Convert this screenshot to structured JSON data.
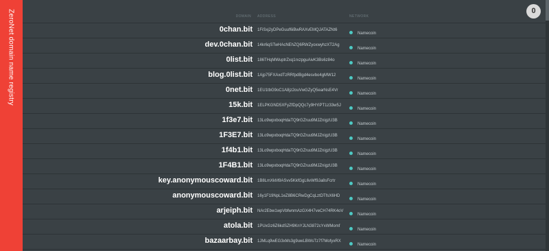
{
  "sidebar": {
    "title": "ZeroNet domain name registry"
  },
  "badge": {
    "count": "0"
  },
  "table": {
    "headers": {
      "domain": "DOMAIN",
      "address": "ADDRESS",
      "network": "NETWORK"
    },
    "rows": [
      {
        "domain": "0chan.bit",
        "address": "1FiSxj2yDPeGuuf6iBwRAXvEMQJATAZNt6",
        "network": "Namecoin"
      },
      {
        "domain": "dev.0chan.bit",
        "address": "14kr6qSTwHAcNEhZQ6RWZyoxwyhzXT2Ag",
        "network": "Namecoin"
      },
      {
        "domain": "0list.bit",
        "address": "186THqMWuptrZxq1rxzpguAivK3Bs6z84o",
        "network": "Namecoin"
      },
      {
        "domain": "blog.0list.bit",
        "address": "1Ajp75FXAxdTzRRfpdBgd4esvbo4gMW12",
        "network": "Namecoin"
      },
      {
        "domain": "0net.bit",
        "address": "1EU1tbG9oC1A8jz2ouVwGZyQ5earNsE4Vr",
        "network": "Namecoin"
      },
      {
        "domain": "15k.bit",
        "address": "1ELPKGND5XFyZfDpQQc7y9HYiPT1z33w5J",
        "network": "Namecoin"
      },
      {
        "domain": "1f3e7.bit",
        "address": "13Lo9wpxboqHdaTQ9rGZruu9MJZnigzU3B",
        "network": "Namecoin"
      },
      {
        "domain": "1F3E7.bit",
        "address": "13Lo9wpxboqHdaTQ9rGZruu9MJZnigzU3B",
        "network": "Namecoin"
      },
      {
        "domain": "1f4b1.bit",
        "address": "13Lo9wpxboqHdaTQ9rGZruu9MJZnigzU3B",
        "network": "Namecoin"
      },
      {
        "domain": "1F4B1.bit",
        "address": "13Lo9wpxboqHdaTQ9rGZruu9MJZnigzU3B",
        "network": "Namecoin"
      },
      {
        "domain": "key.anonymouscoward.bit",
        "address": "1B8LmXkM9ASvv5KkfGgL6vWf9Ja8sFcrtr",
        "network": "Namecoin"
      },
      {
        "domain": "anonymouscoward.bit",
        "address": "16y1F19NpL1eZ8B6CRwDgCqLztDTfsX6HD",
        "network": "Namecoin"
      },
      {
        "domain": "arjeiph.bit",
        "address": "NAr2Ebw1wpVbfwnmAzGX4H7veCH74RK4oV",
        "network": "Namecoin"
      },
      {
        "domain": "atola.bit",
        "address": "1PUxGz6Z6kdSZH9KnYJLN3872cYxWMomf",
        "network": "Namecoin"
      },
      {
        "domain": "bazaarbay.bit",
        "address": "1JMLq9wEG3xMs3g9uwLBWsTz7f7MofyxRX",
        "network": "Namecoin"
      }
    ]
  },
  "colors": {
    "accent": "#ef4136",
    "background": "#3a4145",
    "status_dot": "#4ec9c3"
  }
}
